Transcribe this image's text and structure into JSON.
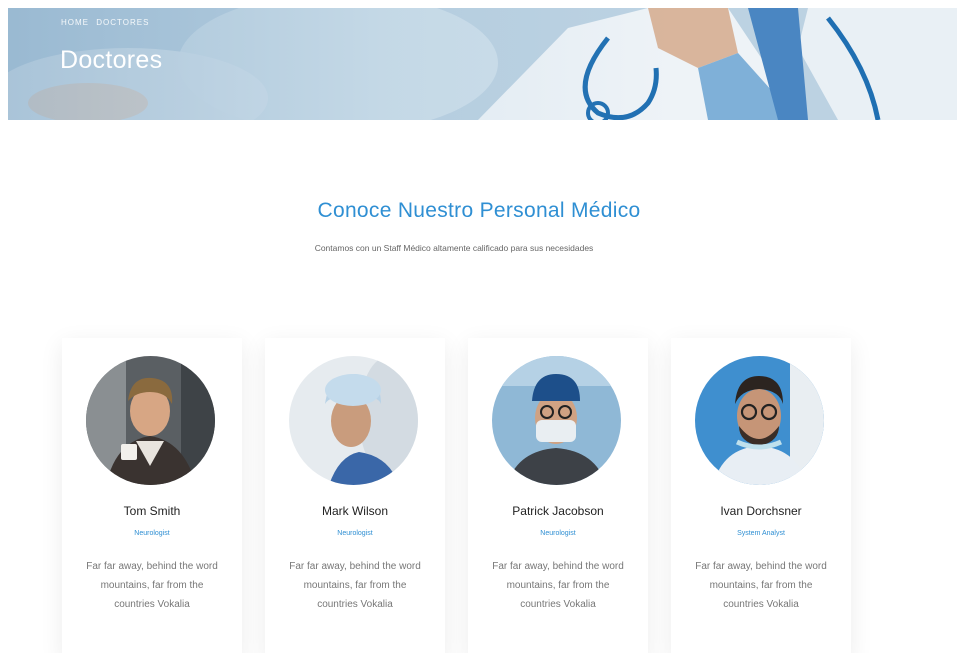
{
  "hero": {
    "breadcrumb": [
      "Home",
      "Doctores"
    ],
    "title": "Doctores"
  },
  "section": {
    "title": "Conoce Nuestro Personal Médico",
    "subtitle": "Contamos con un Staff Médico altamente calificado para sus necesidades"
  },
  "doctors": [
    {
      "name": "Tom Smith",
      "position": "Neurologist",
      "bio": "Far far away, behind the word mountains, far from the countries Vokalia"
    },
    {
      "name": "Mark Wilson",
      "position": "Neurologist",
      "bio": "Far far away, behind the word mountains, far from the countries Vokalia"
    },
    {
      "name": "Patrick Jacobson",
      "position": "Neurologist",
      "bio": "Far far away, behind the word mountains, far from the countries Vokalia"
    },
    {
      "name": "Ivan Dorchsner",
      "position": "System Analyst",
      "bio": "Far far away, behind the word mountains, far from the countries Vokalia"
    }
  ],
  "colors": {
    "accent": "#2f8fd3",
    "banner": "#b9cfe0",
    "card_bg": "#ffffff"
  }
}
